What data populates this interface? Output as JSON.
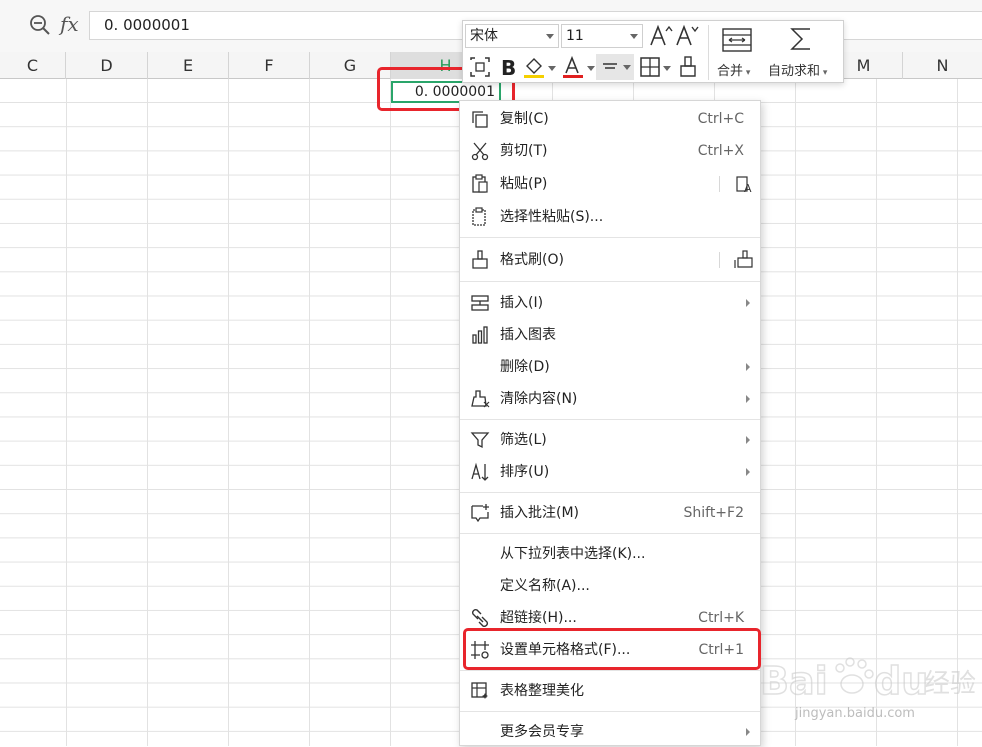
{
  "formula_bar": {
    "fx_label": "fx",
    "value": "0. 0000001"
  },
  "columns": [
    "C",
    "D",
    "E",
    "F",
    "G",
    "H",
    "",
    "",
    "",
    "",
    "M",
    "N"
  ],
  "active_column": "H",
  "active_cell": {
    "value": "0. 0000001"
  },
  "mini_toolbar": {
    "font_name": "宋体",
    "font_size": "11",
    "merge_label": "合并",
    "autosum_label": "自动求和"
  },
  "context_menu": {
    "items": [
      {
        "label": "复制(C)",
        "shortcut": "Ctrl+C"
      },
      {
        "label": "剪切(T)",
        "shortcut": "Ctrl+X"
      },
      {
        "label": "粘贴(P)",
        "shortcut": ""
      },
      {
        "label": "选择性粘贴(S)...",
        "shortcut": ""
      },
      {
        "label": "格式刷(O)",
        "shortcut": ""
      },
      {
        "label": "插入(I)",
        "shortcut": ""
      },
      {
        "label": "插入图表",
        "shortcut": ""
      },
      {
        "label": "删除(D)",
        "shortcut": ""
      },
      {
        "label": "清除内容(N)",
        "shortcut": ""
      },
      {
        "label": "筛选(L)",
        "shortcut": ""
      },
      {
        "label": "排序(U)",
        "shortcut": ""
      },
      {
        "label": "插入批注(M)",
        "shortcut": "Shift+F2"
      },
      {
        "label": "从下拉列表中选择(K)...",
        "shortcut": ""
      },
      {
        "label": "定义名称(A)...",
        "shortcut": ""
      },
      {
        "label": "超链接(H)...",
        "shortcut": "Ctrl+K"
      },
      {
        "label": "设置单元格格式(F)...",
        "shortcut": "Ctrl+1"
      },
      {
        "label": "表格整理美化",
        "shortcut": ""
      },
      {
        "label": "更多会员专享",
        "shortcut": ""
      }
    ]
  },
  "watermark": {
    "brand": "Baidu经验",
    "url": "jingyan.baidu.com"
  },
  "colors": {
    "accent_green": "#2aa56a",
    "highlight_red": "#e8252c",
    "font_color_red": "#e02020",
    "fill_yellow": "#f5d000"
  }
}
